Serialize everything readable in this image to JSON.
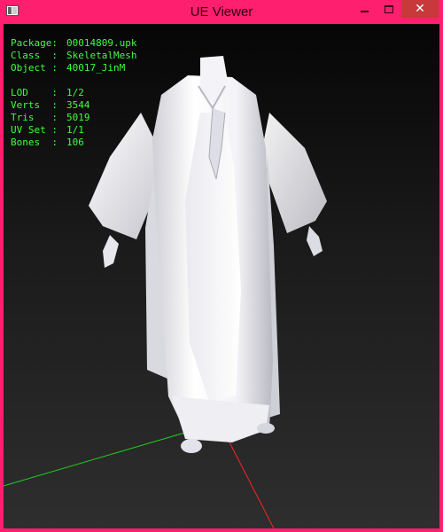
{
  "window": {
    "title": "UE Viewer",
    "accent_color": "#ff1f6e",
    "close_color": "#c7393b",
    "icons": [
      "app-icon",
      "minimize-icon",
      "maximize-icon",
      "close-icon"
    ]
  },
  "info_panel": {
    "text_color": "#3cff3c",
    "package": {
      "key": "Package:",
      "value": "00014809.upk"
    },
    "class": {
      "key": "Class  :",
      "value": "SkeletalMesh"
    },
    "object": {
      "key": "Object :",
      "value": "40017_JinM"
    },
    "lod": {
      "key": "LOD    :",
      "value": "1/2"
    },
    "verts": {
      "key": "Verts  :",
      "value": "3544"
    },
    "tris": {
      "key": "Tris   :",
      "value": "5019"
    },
    "uv_set": {
      "key": "UV Set :",
      "value": "1/1"
    },
    "bones": {
      "key": "Bones  :",
      "value": "106"
    }
  },
  "scene": {
    "model": "white robe skeletal mesh",
    "axis_colors": {
      "x": "#ff2020",
      "y": "#20d020"
    }
  }
}
